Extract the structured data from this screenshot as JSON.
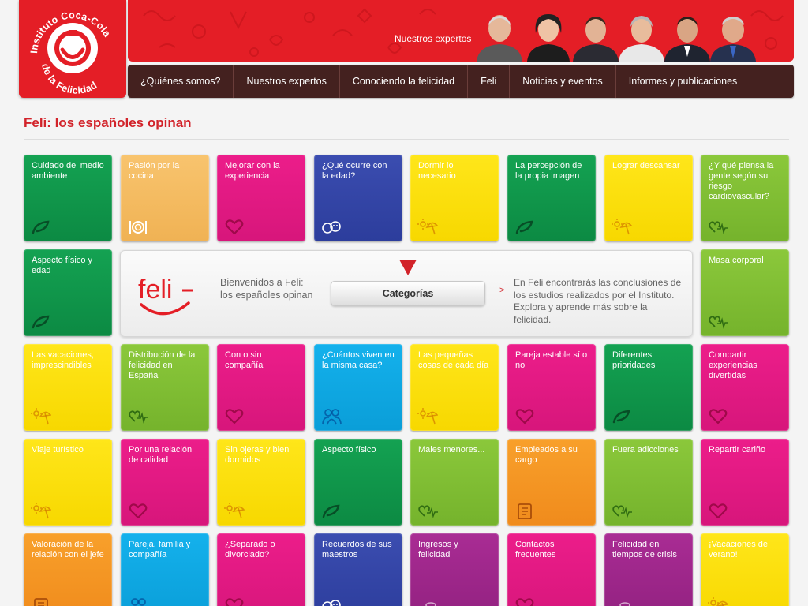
{
  "logo": {
    "line1": "Instituto Coca-Cola",
    "line2": "de la Felicidad"
  },
  "banner": {
    "label": "Nuestros expertos"
  },
  "nav": [
    "¿Quiénes somos?",
    "Nuestros expertos",
    "Conociendo la felicidad",
    "Feli",
    "Noticias y eventos",
    "Informes y publicaciones"
  ],
  "page_title": "Feli: los españoles opinan",
  "panel": {
    "logo_text": "feli",
    "welcome": "Bienvenidos a Feli: los españoles opinan",
    "button": "Categorías",
    "chevron": ">",
    "description": "En Feli encontrarás las conclusiones de los estudios realizados por el Instituto. Explora y aprende más sobre la felicidad."
  },
  "colors": {
    "brand_red": "#e41e26",
    "nav_brown": "#44211f",
    "green": "#0c8a43",
    "light_orange": "#f0b254",
    "magenta": "#d7167b",
    "navy": "#2c3d9c",
    "yellow": "#f7d800",
    "lime": "#75b32c",
    "cyan": "#0a9ed8",
    "orange": "#f08b1c",
    "purple": "#922180"
  },
  "tiles": [
    {
      "label": "Cuidado del medio ambiente",
      "color": "green",
      "icon": "leaf-icon"
    },
    {
      "label": "Pasión por la cocina",
      "color": "lorange",
      "icon": "plate-cutlery-icon"
    },
    {
      "label": "Mejorar con la experiencia",
      "color": "magenta",
      "icon": "heart-icon"
    },
    {
      "label": "¿Qué ocurre con la edad?",
      "color": "navy",
      "icon": "faces-icon"
    },
    {
      "label": "Dormir lo necesario",
      "color": "yellow",
      "icon": "sun-umbrella-icon"
    },
    {
      "label": "La percepción de la propia imagen",
      "color": "green",
      "icon": "leaf-icon"
    },
    {
      "label": "Lograr descansar",
      "color": "yellow",
      "icon": "sun-umbrella-icon"
    },
    {
      "label": "¿Y qué piensa la gente según su riesgo cardiovascular?",
      "color": "lime",
      "icon": "heartbeat-icon"
    },
    {
      "label": "Aspecto físico y edad",
      "color": "green",
      "icon": "leaf-icon"
    },
    {
      "label": "Masa corporal",
      "color": "lime",
      "icon": "heartbeat-icon"
    },
    {
      "label": "Las vacaciones, imprescindibles",
      "color": "yellow",
      "icon": "sun-umbrella-icon"
    },
    {
      "label": "Distribución de la felicidad en España",
      "color": "lime",
      "icon": "heartbeat-icon"
    },
    {
      "label": "Con o sin compañía",
      "color": "magenta",
      "icon": "heart-icon"
    },
    {
      "label": "¿Cuántos viven en la misma casa?",
      "color": "cyan",
      "icon": "people-icon"
    },
    {
      "label": "Las pequeñas cosas de cada día",
      "color": "yellow",
      "icon": "sun-umbrella-icon"
    },
    {
      "label": "Pareja estable sí o no",
      "color": "magenta",
      "icon": "heart-icon"
    },
    {
      "label": "Diferentes prioridades",
      "color": "green",
      "icon": "leaf-icon"
    },
    {
      "label": "Compartir experiencias divertidas",
      "color": "magenta",
      "icon": "heart-icon"
    },
    {
      "label": "Viaje turístico",
      "color": "yellow",
      "icon": "sun-umbrella-icon"
    },
    {
      "label": "Por una relación de calidad",
      "color": "magenta",
      "icon": "heart-icon"
    },
    {
      "label": "Sin ojeras y bien dormidos",
      "color": "yellow",
      "icon": "sun-umbrella-icon"
    },
    {
      "label": "Aspecto físico",
      "color": "green",
      "icon": "leaf-icon"
    },
    {
      "label": "Males menores...",
      "color": "lime",
      "icon": "heartbeat-icon"
    },
    {
      "label": "Empleados a su cargo",
      "color": "orange",
      "icon": "clipboard-icon"
    },
    {
      "label": "Fuera adicciones",
      "color": "lime",
      "icon": "heartbeat-icon"
    },
    {
      "label": "Repartir cariño",
      "color": "magenta",
      "icon": "heart-icon"
    },
    {
      "label": "Valoración de la relación con el jefe",
      "color": "orange",
      "icon": "clipboard-icon"
    },
    {
      "label": "Pareja, familia y compañía",
      "color": "cyan",
      "icon": "people-icon"
    },
    {
      "label": "¿Separado o divorciado?",
      "color": "magenta",
      "icon": "heart-icon"
    },
    {
      "label": "Recuerdos de sus maestros",
      "color": "navy",
      "icon": "faces-icon"
    },
    {
      "label": "Ingresos y felicidad",
      "color": "purple",
      "icon": "coins-icon"
    },
    {
      "label": "Contactos frecuentes",
      "color": "magenta",
      "icon": "heart-icon"
    },
    {
      "label": "Felicidad en tiempos de crisis",
      "color": "purple",
      "icon": "coins-icon"
    },
    {
      "label": "¡Vacaciones de verano!",
      "color": "yellow",
      "icon": "sun-umbrella-icon"
    }
  ]
}
